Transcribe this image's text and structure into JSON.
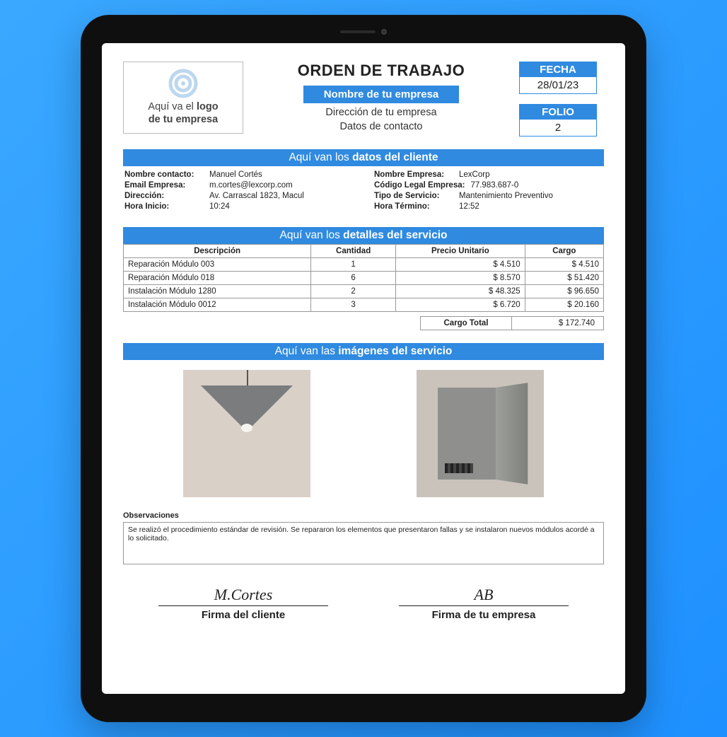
{
  "title": "ORDEN DE TRABAJO",
  "logo_text_1": "Aquí va el",
  "logo_text_2": "logo",
  "logo_text_3": "de tu empresa",
  "company_chip": "Nombre de tu empresa",
  "company_addr": "Dirección de tu empresa",
  "company_contact": "Datos de contacto",
  "fecha_label": "FECHA",
  "fecha_value": "28/01/23",
  "folio_label": "FOLIO",
  "folio_value": "2",
  "section_client_light": "Aquí van los ",
  "section_client_bold": "datos del cliente",
  "section_details_light": "Aquí van los ",
  "section_details_bold": "detalles del servicio",
  "section_images_light": "Aquí van las ",
  "section_images_bold": "imágenes del servicio",
  "client_left": [
    {
      "k": "Nombre contacto:",
      "v": "Manuel Cortés"
    },
    {
      "k": "Email Empresa:",
      "v": "m.cortes@lexcorp.com"
    },
    {
      "k": "Dirección:",
      "v": "Av. Carrascal 1823, Macul"
    },
    {
      "k": "Hora Inicio:",
      "v": "10:24"
    }
  ],
  "client_right": [
    {
      "k": "Nombre Empresa:",
      "v": "LexCorp"
    },
    {
      "k": "Código Legal Empresa:",
      "v": "77.983.687-0"
    },
    {
      "k": "Tipo de Servicio:",
      "v": "Mantenimiento Preventivo"
    },
    {
      "k": "Hora Término:",
      "v": "12:52"
    }
  ],
  "table": {
    "headers": [
      "Descripción",
      "Cantidad",
      "Precio Unitario",
      "Cargo"
    ],
    "rows": [
      [
        "Reparación Módulo 003",
        "1",
        "$ 4.510",
        "$ 4.510"
      ],
      [
        "Reparación Módulo 018",
        "6",
        "$ 8.570",
        "$ 51.420"
      ],
      [
        "Instalación Módulo 1280",
        "2",
        "$ 48.325",
        "$ 96.650"
      ],
      [
        "Instalación Módulo 0012",
        "3",
        "$ 6.720",
        "$ 20.160"
      ]
    ],
    "total_label": "Cargo Total",
    "total_value": "$ 172.740"
  },
  "obs_label": "Observaciones",
  "obs_text": "Se realizó el procedimiento estándar de revisión. Se repararon los elementos que presentaron fallas y se instalaron nuevos módulos acordé a lo solicitado.",
  "sig_client_scribble": "M.Cortes",
  "sig_client_label": "Firma del cliente",
  "sig_company_scribble": "AB",
  "sig_company_label": "Firma de tu empresa"
}
